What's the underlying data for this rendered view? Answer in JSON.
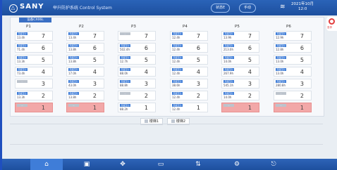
{
  "header": {
    "brand": "SANY",
    "system_title": "举升防护系统 Control System",
    "status_pill_1": "状态E",
    "status_pill_2": "手动",
    "datetime_line1": "2021年10月",
    "datetime_line2": "12:0"
  },
  "alert": {
    "label": "急停"
  },
  "panel": {
    "tab_title": "设备CX06L",
    "columns": [
      "P1",
      "P2",
      "P3",
      "P4",
      "P5",
      "P6"
    ],
    "levels": [
      "7",
      "6",
      "5",
      "4",
      "3",
      "2",
      "1"
    ],
    "grid": [
      [
        {
          "tag": "高度压力",
          "val": "13.4h",
          "lvl": "7",
          "state": "normal"
        },
        {
          "tag": "高度压力",
          "val": "13.4h",
          "lvl": "7",
          "state": "normal"
        },
        {
          "tag": "--",
          "val": "",
          "lvl": "7",
          "state": "empty"
        },
        {
          "tag": "高度压力",
          "val": "12.4h",
          "lvl": "7",
          "state": "normal"
        },
        {
          "tag": "高度压力",
          "val": "13.9h",
          "lvl": "7",
          "state": "normal"
        },
        {
          "tag": "高度压力",
          "val": "12.9h",
          "lvl": "7",
          "state": "normal"
        }
      ],
      [
        {
          "tag": "高度压力",
          "val": "71.4h",
          "lvl": "6",
          "state": "normal"
        },
        {
          "tag": "高度压力",
          "val": "13.8h",
          "lvl": "6",
          "state": "normal"
        },
        {
          "tag": "高度压力",
          "val": "502.4h",
          "lvl": "6",
          "state": "normal"
        },
        {
          "tag": "高度压力",
          "val": "12.4h",
          "lvl": "6",
          "state": "normal"
        },
        {
          "tag": "高度压力",
          "val": "213.0h",
          "lvl": "6",
          "state": "normal"
        },
        {
          "tag": "高度压力",
          "val": "12.8h",
          "lvl": "6",
          "state": "normal"
        }
      ],
      [
        {
          "tag": "高度压力",
          "val": "13.3h",
          "lvl": "5",
          "state": "normal"
        },
        {
          "tag": "高度压力",
          "val": "13.8h",
          "lvl": "5",
          "state": "normal"
        },
        {
          "tag": "高度压力",
          "val": "12.7h",
          "lvl": "5",
          "state": "normal"
        },
        {
          "tag": "高度压力",
          "val": "12.4h",
          "lvl": "5",
          "state": "normal"
        },
        {
          "tag": "高度压力",
          "val": "14.0h",
          "lvl": "5",
          "state": "normal"
        },
        {
          "tag": "高度压力",
          "val": "13.0h",
          "lvl": "5",
          "state": "normal"
        }
      ],
      [
        {
          "tag": "高度压力",
          "val": "73.4h",
          "lvl": "4",
          "state": "normal"
        },
        {
          "tag": "高度压力",
          "val": "17.0h",
          "lvl": "4",
          "state": "normal"
        },
        {
          "tag": "高度压力",
          "val": "88.0h",
          "lvl": "4",
          "state": "normal"
        },
        {
          "tag": "高度压力",
          "val": "12.4h",
          "lvl": "4",
          "state": "normal"
        },
        {
          "tag": "高度压力",
          "val": "267.9h",
          "lvl": "4",
          "state": "normal"
        },
        {
          "tag": "高度压力",
          "val": "13.0h",
          "lvl": "4",
          "state": "normal"
        }
      ],
      [
        {
          "tag": "--",
          "val": "",
          "lvl": "3",
          "state": "empty"
        },
        {
          "tag": "高度压力",
          "val": "43.0h",
          "lvl": "3",
          "state": "normal"
        },
        {
          "tag": "高度压力",
          "val": "88.8h",
          "lvl": "3",
          "state": "normal"
        },
        {
          "tag": "高度压力",
          "val": "38.6h",
          "lvl": "3",
          "state": "normal"
        },
        {
          "tag": "高度压力",
          "val": "545.1h",
          "lvl": "3",
          "state": "normal"
        },
        {
          "tag": "高度压力",
          "val": "280.8h",
          "lvl": "3",
          "state": "normal"
        }
      ],
      [
        {
          "tag": "高度压力",
          "val": "13.3h",
          "lvl": "2",
          "state": "normal"
        },
        {
          "tag": "高度压力",
          "val": "13.8h",
          "lvl": "2",
          "state": "normal"
        },
        {
          "tag": "--",
          "val": "",
          "lvl": "2",
          "state": "empty"
        },
        {
          "tag": "高度压力",
          "val": "12.4h",
          "lvl": "2",
          "state": "normal"
        },
        {
          "tag": "高度压力",
          "val": "14.0h",
          "lvl": "2",
          "state": "normal"
        },
        {
          "tag": "--",
          "val": "",
          "lvl": "2",
          "state": "empty"
        }
      ],
      [
        {
          "tag": "--",
          "val": "",
          "lvl": "1",
          "state": "alarm"
        },
        {
          "tag": "--",
          "val": "",
          "lvl": "1",
          "state": "alarm"
        },
        {
          "tag": "高度压力",
          "val": "88.2h",
          "lvl": "1",
          "state": "normal"
        },
        {
          "tag": "高度压力",
          "val": "12.4h",
          "lvl": "1",
          "state": "normal"
        },
        {
          "tag": "--",
          "val": "",
          "lvl": "1",
          "state": "alarm"
        },
        {
          "tag": "--",
          "val": "",
          "lvl": "1",
          "state": "alarm"
        }
      ]
    ],
    "stairs": [
      "楼梯1",
      "楼梯2"
    ]
  },
  "nav": [
    {
      "icon": "home-icon",
      "glyph": "⌂"
    },
    {
      "icon": "devices-icon",
      "glyph": "▣"
    },
    {
      "icon": "move-icon",
      "glyph": "✥"
    },
    {
      "icon": "monitor-icon",
      "glyph": "▭"
    },
    {
      "icon": "sort-icon",
      "glyph": "⇅"
    },
    {
      "icon": "settings-icon",
      "glyph": "⚙"
    },
    {
      "icon": "exit-icon",
      "glyph": "⎋"
    }
  ],
  "colors": {
    "accent": "#1d4f9e",
    "tag_blue": "#3b7ad6",
    "alarm": "#f2a8a8"
  }
}
